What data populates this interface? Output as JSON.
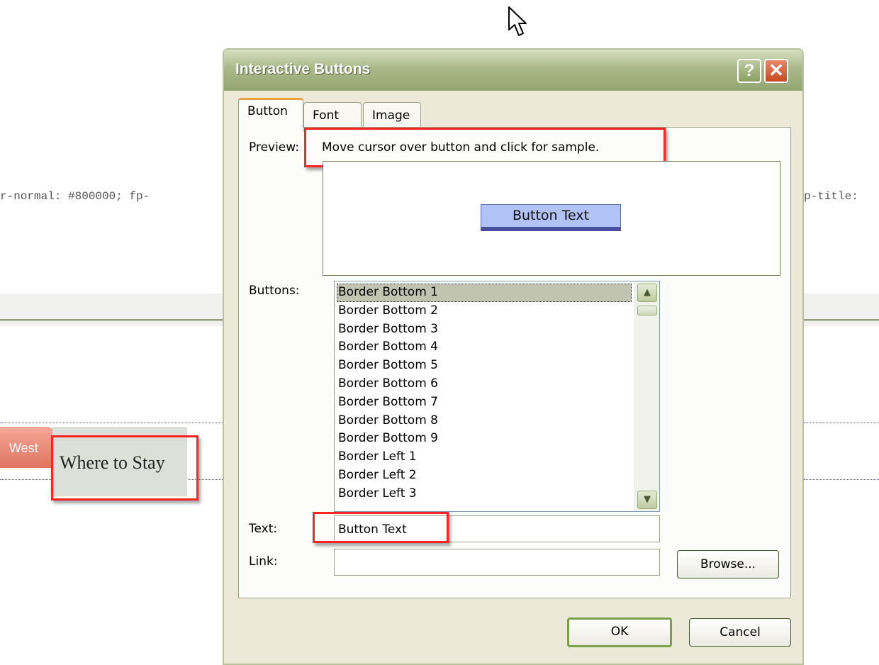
{
  "background_page": {
    "css_left": "r-normal: #800000; fp-",
    "css_right": "p-title:",
    "nav_tab_label": "West",
    "nav_item_label": "Where to Stay"
  },
  "dialog": {
    "title": "Interactive Buttons",
    "help_label": "?",
    "close_label": "✕",
    "tabs": [
      {
        "label": "Button",
        "active": true
      },
      {
        "label": "Font",
        "active": false
      },
      {
        "label": "Image",
        "active": false
      }
    ],
    "preview": {
      "label": "Preview:",
      "hint": "Move cursor over button and click for sample.",
      "sample_button_text": "Button Text"
    },
    "buttons_list": {
      "label": "Buttons:",
      "selected_index": 0,
      "items": [
        "Border Bottom 1",
        "Border Bottom 2",
        "Border Bottom 3",
        "Border Bottom 4",
        "Border Bottom 5",
        "Border Bottom 6",
        "Border Bottom 7",
        "Border Bottom 8",
        "Border Bottom 9",
        "Border Left 1",
        "Border Left 2",
        "Border Left 3"
      ]
    },
    "text_field": {
      "label": "Text:",
      "value": "Button Text"
    },
    "link_field": {
      "label": "Link:",
      "value": ""
    },
    "browse_label": "Browse...",
    "ok_label": "OK",
    "cancel_label": "Cancel"
  },
  "colors": {
    "highlight": "#ff2424",
    "titlebar": "#94a672",
    "close_button": "#c6491f",
    "sample_button_bg": "#b1c2f6"
  }
}
